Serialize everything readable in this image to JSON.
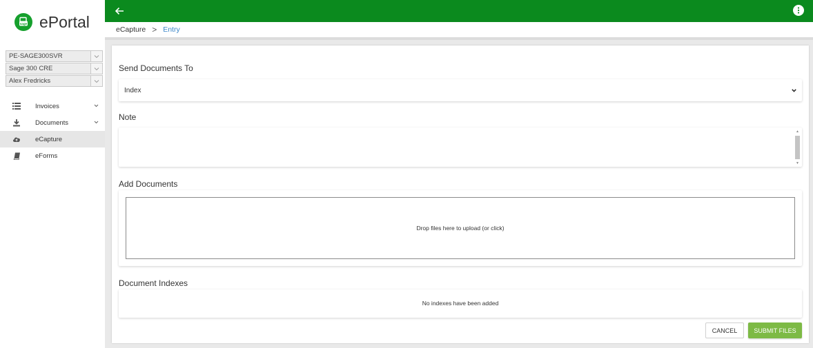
{
  "app": {
    "name": "ePortal",
    "logo_icon": "sage-logo-icon",
    "brand_color": "#0b8a1e"
  },
  "selectors": [
    {
      "value": "PE-SAGE300SVR"
    },
    {
      "value": "Sage 300 CRE"
    },
    {
      "value": "Alex Fredricks"
    }
  ],
  "nav": {
    "items": [
      {
        "label": "Invoices",
        "icon": "list-icon",
        "expandable": true
      },
      {
        "label": "Documents",
        "icon": "download-icon",
        "expandable": true
      },
      {
        "label": "eCapture",
        "icon": "cloud-upload-icon",
        "active": true
      },
      {
        "label": "eForms",
        "icon": "book-icon"
      }
    ]
  },
  "header": {
    "back_icon": "arrow-left-icon",
    "more_icon": "more-vertical-icon"
  },
  "breadcrumb": {
    "items": [
      "eCapture",
      "Entry"
    ],
    "separator": ">"
  },
  "form": {
    "send_to_label": "Send Documents To",
    "send_to_value": "Index",
    "note_label": "Note",
    "add_docs_label": "Add Documents",
    "dropzone_text": "Drop files here to upload (or click)",
    "indexes_label": "Document Indexes",
    "indexes_empty": "No indexes have been added",
    "cancel_label": "CANCEL",
    "submit_label": "SUBMIT FILES",
    "submit_color": "#7dba45"
  }
}
